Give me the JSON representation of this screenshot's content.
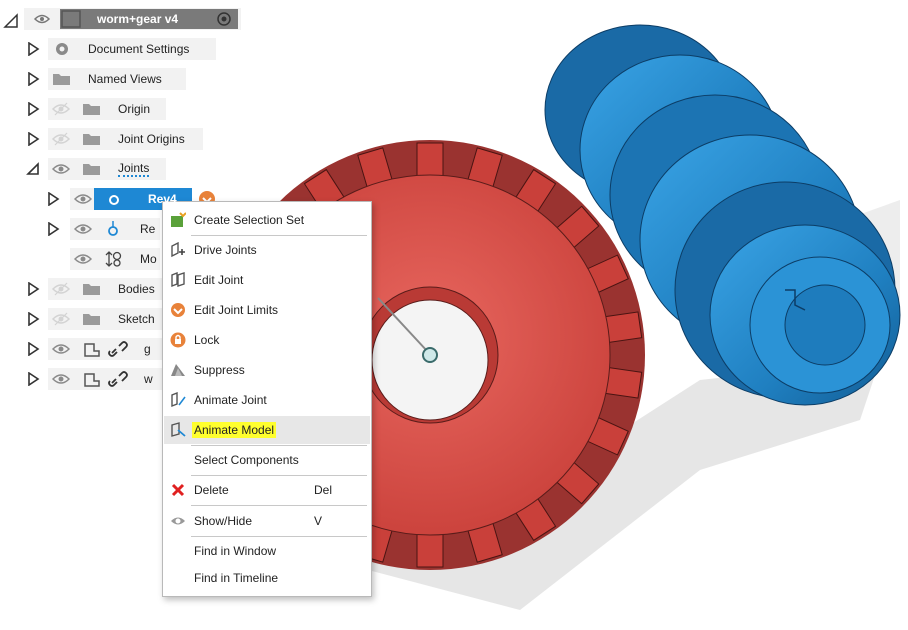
{
  "browser": {
    "root": {
      "label": "worm+gear v4"
    },
    "items": [
      {
        "label": "Document Settings"
      },
      {
        "label": "Named Views"
      },
      {
        "label": "Origin"
      },
      {
        "label": "Joint Origins"
      },
      {
        "label": "Joints"
      },
      {
        "label": "Rev4"
      },
      {
        "label": "Re"
      },
      {
        "label": "Mo"
      },
      {
        "label": "Bodies"
      },
      {
        "label": "Sketch"
      },
      {
        "label": "g"
      },
      {
        "label": "w"
      }
    ]
  },
  "context_menu": {
    "items": [
      {
        "label": "Create Selection Set",
        "icon": "selection-set-icon"
      },
      {
        "label": "Drive Joints",
        "icon": "drive-joints-icon"
      },
      {
        "label": "Edit Joint",
        "icon": "edit-joint-icon"
      },
      {
        "label": "Edit Joint Limits",
        "icon": "joint-limits-icon"
      },
      {
        "label": "Lock",
        "icon": "lock-icon"
      },
      {
        "label": "Suppress",
        "icon": "suppress-icon"
      },
      {
        "label": "Animate Joint",
        "icon": "animate-joint-icon"
      },
      {
        "label": "Animate Model",
        "icon": "animate-model-icon",
        "highlighted": true
      },
      {
        "label": "Select Components"
      },
      {
        "label": "Delete",
        "shortcut": "Del",
        "icon": "delete-icon"
      },
      {
        "label": "Show/Hide",
        "shortcut": "V",
        "icon": "eye-icon"
      },
      {
        "label": "Find in Window"
      },
      {
        "label": "Find in Timeline"
      }
    ]
  },
  "colors": {
    "gear": "#d9534f",
    "worm": "#1f7fc0",
    "selection": "#1e88d4",
    "highlight": "#ffff2e"
  }
}
